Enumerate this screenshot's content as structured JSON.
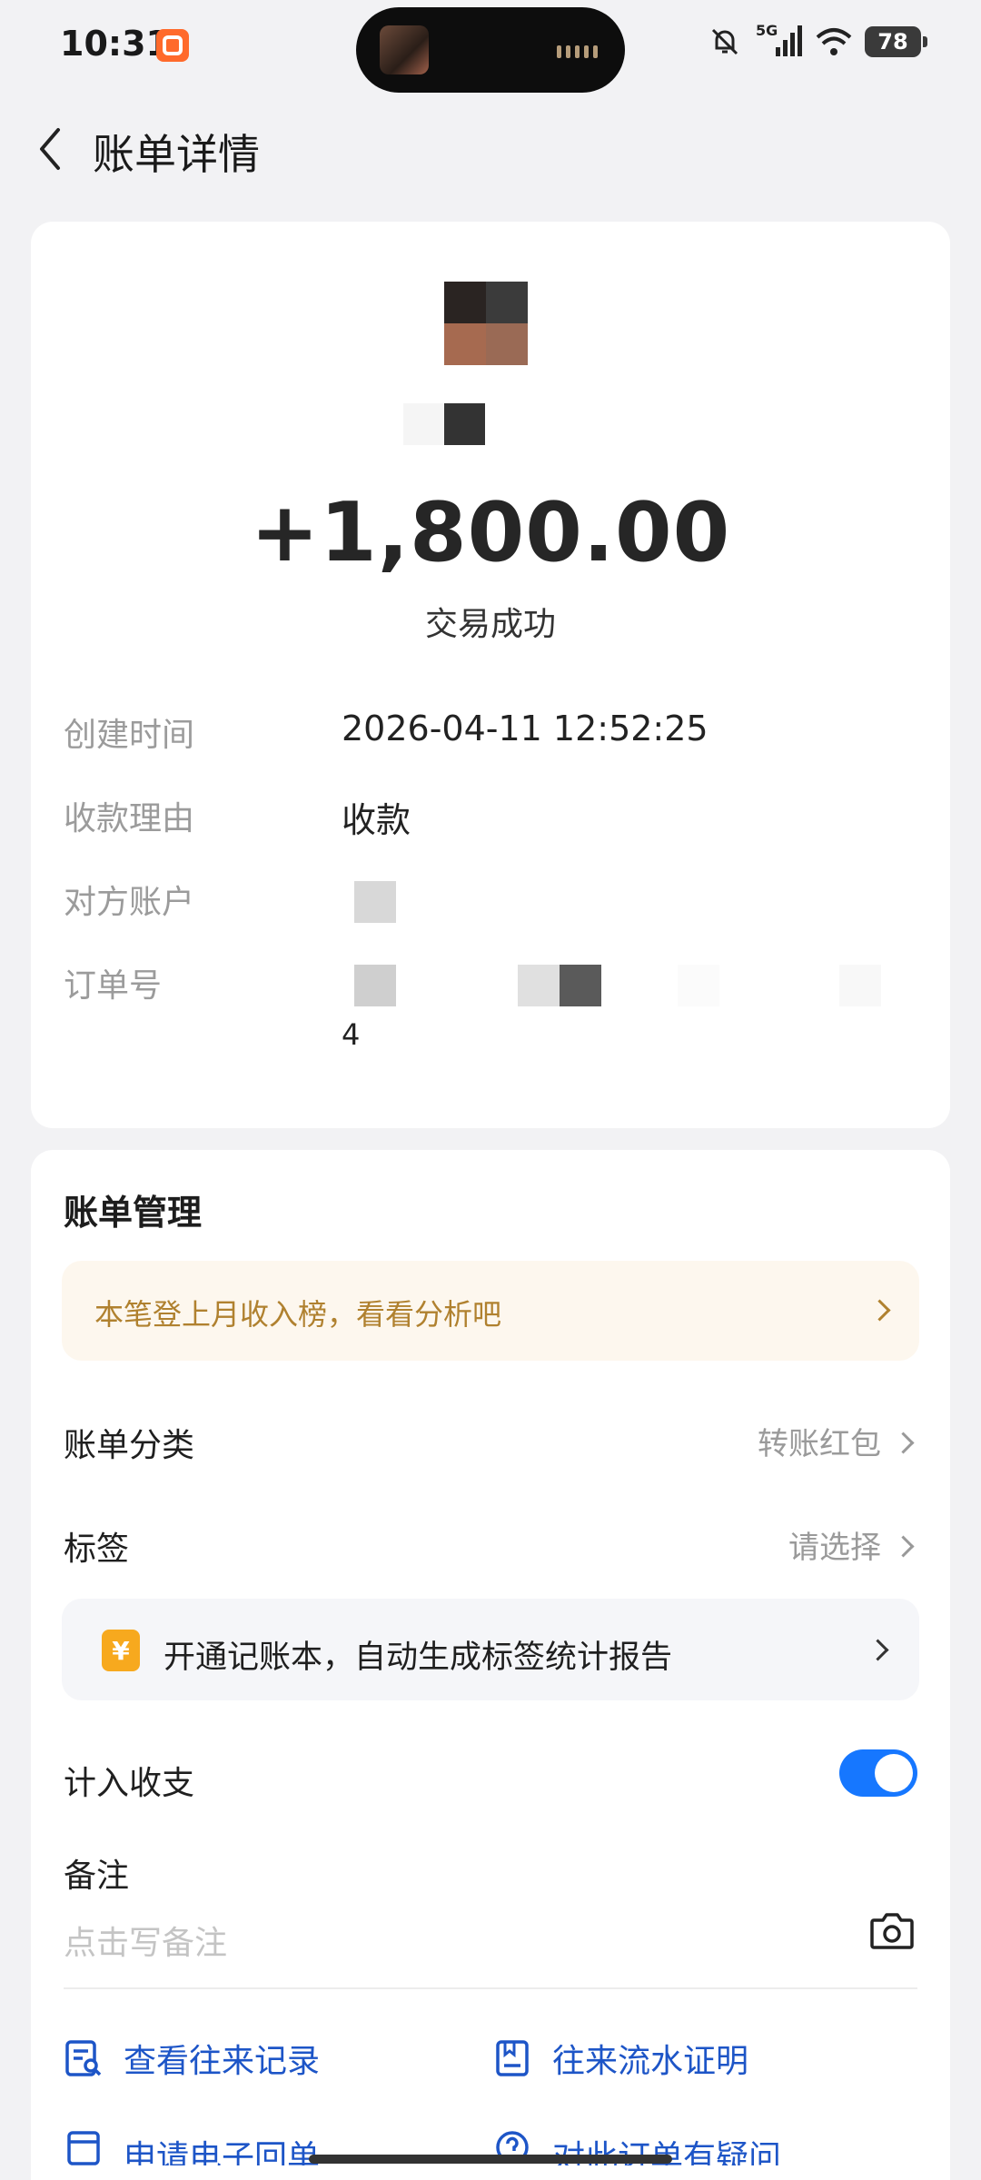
{
  "status_bar": {
    "time": "10:31",
    "network": "5G",
    "battery": "78"
  },
  "header": {
    "title": "账单详情"
  },
  "transaction": {
    "amount": "+1,800.00",
    "status": "交易成功",
    "fields": [
      {
        "label": "创建时间",
        "value": "2026-04-11 12:52:25"
      },
      {
        "label": "收款理由",
        "value": "收款"
      },
      {
        "label": "对方账户",
        "value": ""
      },
      {
        "label": "订单号",
        "value": "4"
      }
    ]
  },
  "manage": {
    "title": "账单管理",
    "promo": "本笔登上月收入榜，看看分析吧",
    "category_label": "账单分类",
    "category_value": "转账红包",
    "tag_label": "标签",
    "tag_value": "请选择",
    "ledger_icon": "¥",
    "ledger_text": "开通记账本，自动生成标签统计报告",
    "count_label": "计入收支",
    "count_enabled": true,
    "note_label": "备注",
    "note_placeholder": "点击写备注",
    "links": [
      {
        "label": "查看往来记录",
        "icon": "record-search-icon"
      },
      {
        "label": "往来流水证明",
        "icon": "statement-icon"
      },
      {
        "label": "申请电子回单",
        "icon": "receipt-icon"
      },
      {
        "label": "对此订单有疑问",
        "icon": "question-icon"
      }
    ]
  },
  "colors": {
    "accent": "#1677ff",
    "link": "#1d55c7",
    "promo_text": "#b0812f",
    "background": "#f2f2f4"
  }
}
